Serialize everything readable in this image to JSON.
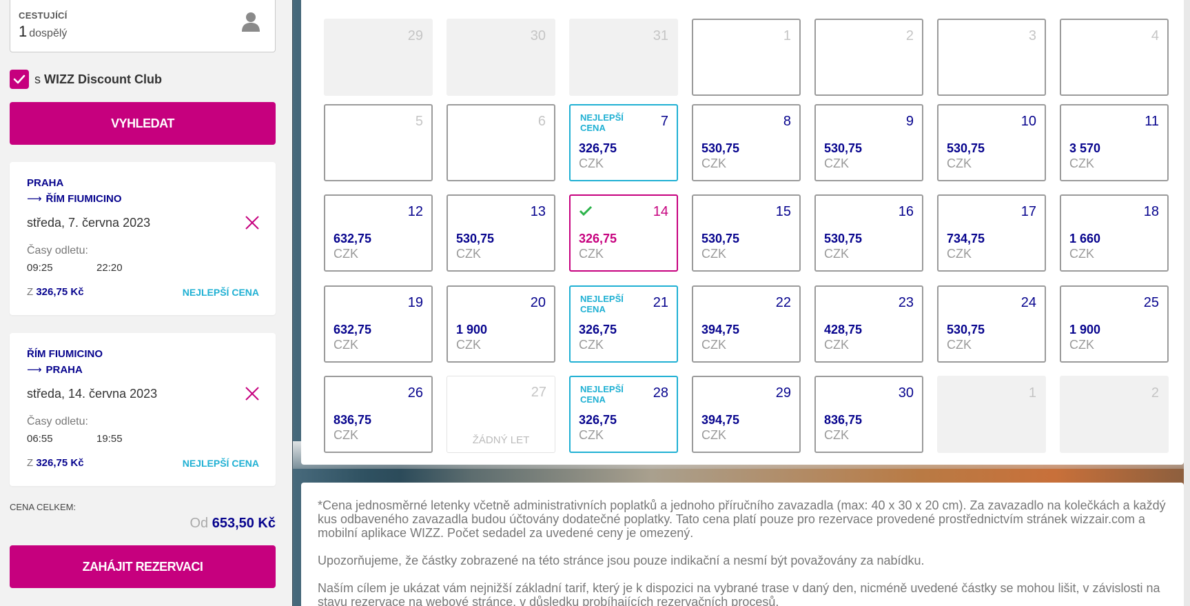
{
  "passengers": {
    "label": "CESTUJÍCÍ",
    "count": "1",
    "type": "dospělý",
    "icon": "person-icon"
  },
  "club": {
    "prefix": "s",
    "name": "WIZZ Discount Club",
    "checked": true
  },
  "search_button": "VYHLEDAT",
  "outbound": {
    "from": "PRAHA",
    "to": "ŘÍM FIUMICINO",
    "arrow": "⟶",
    "date": "středa, 7. června 2023",
    "times_label": "Časy odletu:",
    "time1": "09:25",
    "time2": "22:20",
    "price_prefix": "Z",
    "price": "326,75 Kč",
    "badge": "NEJLEPŠÍ CENA"
  },
  "return": {
    "from": "ŘÍM FIUMICINO",
    "to": "PRAHA",
    "arrow": "⟶",
    "date": "středa, 14. června 2023",
    "times_label": "Časy odletu:",
    "time1": "06:55",
    "time2": "19:55",
    "price_prefix": "Z",
    "price": "326,75 Kč",
    "badge": "NEJLEPŠÍ CENA"
  },
  "total": {
    "label": "CENA CELKEM:",
    "prefix": "Od",
    "value": "653,50 Kč"
  },
  "book_button": "ZAHÁJIT REZERVACI",
  "calendar": {
    "currency": "CZK",
    "best_label_1": "NEJLEPŠÍ",
    "best_label_2": "CENA",
    "no_flight": "ŽÁDNÝ LET",
    "days": [
      {
        "n": "29",
        "state": "dim"
      },
      {
        "n": "30",
        "state": "dim"
      },
      {
        "n": "31",
        "state": "dim"
      },
      {
        "n": "1",
        "state": "empty"
      },
      {
        "n": "2",
        "state": "empty"
      },
      {
        "n": "3",
        "state": "empty"
      },
      {
        "n": "4",
        "state": "empty"
      },
      {
        "n": "5",
        "state": "empty"
      },
      {
        "n": "6",
        "state": "empty"
      },
      {
        "n": "7",
        "state": "best",
        "price": "326,75"
      },
      {
        "n": "8",
        "state": "price",
        "price": "530,75"
      },
      {
        "n": "9",
        "state": "price",
        "price": "530,75"
      },
      {
        "n": "10",
        "state": "price",
        "price": "530,75"
      },
      {
        "n": "11",
        "state": "price",
        "price": "3 570"
      },
      {
        "n": "12",
        "state": "price",
        "price": "632,75"
      },
      {
        "n": "13",
        "state": "price",
        "price": "530,75"
      },
      {
        "n": "14",
        "state": "selected",
        "price": "326,75"
      },
      {
        "n": "15",
        "state": "price",
        "price": "530,75"
      },
      {
        "n": "16",
        "state": "price",
        "price": "530,75"
      },
      {
        "n": "17",
        "state": "price",
        "price": "734,75"
      },
      {
        "n": "18",
        "state": "price",
        "price": "1 660"
      },
      {
        "n": "19",
        "state": "price",
        "price": "632,75"
      },
      {
        "n": "20",
        "state": "price",
        "price": "1 900"
      },
      {
        "n": "21",
        "state": "best",
        "price": "326,75"
      },
      {
        "n": "22",
        "state": "price",
        "price": "394,75"
      },
      {
        "n": "23",
        "state": "price",
        "price": "428,75"
      },
      {
        "n": "24",
        "state": "price",
        "price": "530,75"
      },
      {
        "n": "25",
        "state": "price",
        "price": "1 900"
      },
      {
        "n": "26",
        "state": "price",
        "price": "836,75"
      },
      {
        "n": "27",
        "state": "nolet"
      },
      {
        "n": "28",
        "state": "best",
        "price": "326,75"
      },
      {
        "n": "29",
        "state": "price",
        "price": "394,75"
      },
      {
        "n": "30",
        "state": "price",
        "price": "836,75"
      },
      {
        "n": "1",
        "state": "dim"
      },
      {
        "n": "2",
        "state": "dim"
      }
    ]
  },
  "disclaimer": [
    "*Cena jednosměrné letenky včetně administrativních poplatků a jednoho příručního zavazadla (max: 40 x 30 x 20 cm). Za zavazadlo na kolečkách a každý kus odbaveného zavazadla budou účtovány dodatečné poplatky. Tato cena platí pouze pro rezervace provedené prostřednictvím stránek wizzair.com a mobilní aplikace WIZZ. Počet sedadel za uvedené ceny je omezený.",
    "Upozorňujeme, že částky zobrazené na této stránce jsou pouze indikační a nesmí být považovány za nabídku.",
    "Naším cílem je ukázat vám nejnižší základní tarif, který je k dispozici na vybrané trase v daný den, nicméně uvedené částky se mohou lišit, v závislosti na stavu rezervace na webové stránce, v důsledku probíhajících rezervačních procesů."
  ],
  "colors": {
    "brand": "#c6007e",
    "navy": "#06038d",
    "best": "#1fb0d3"
  }
}
